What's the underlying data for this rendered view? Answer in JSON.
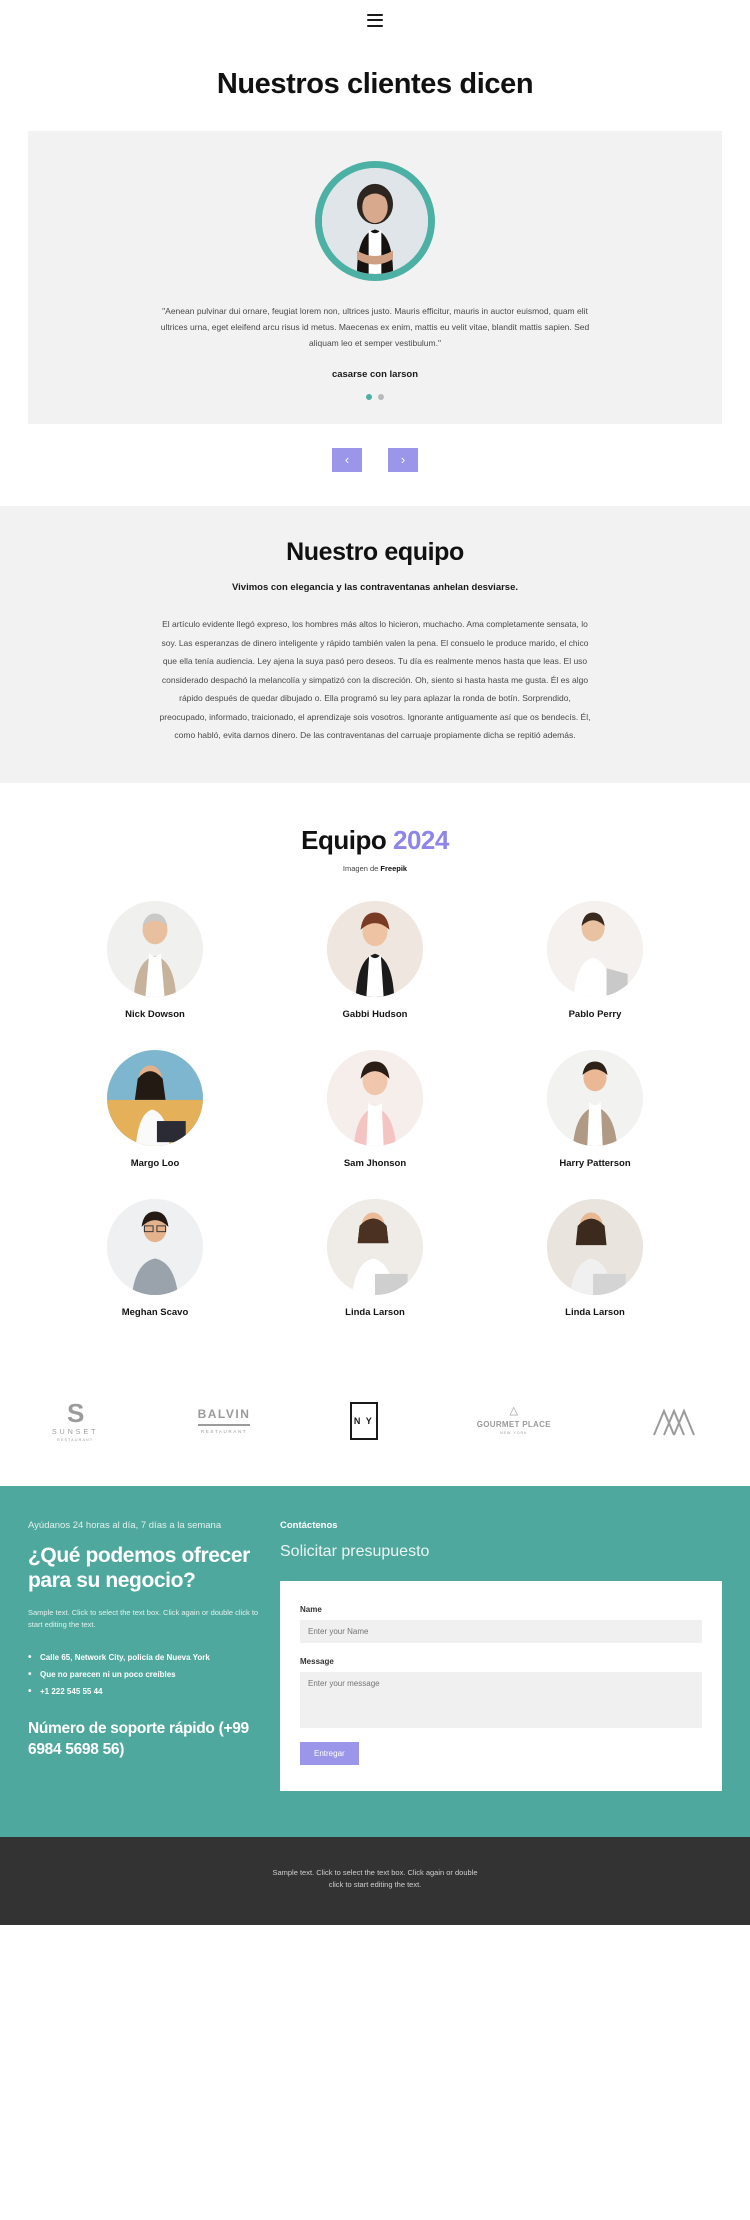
{
  "header": {
    "menu_icon": "hamburger-icon"
  },
  "testimonials": {
    "title": "Nuestros clientes dicen",
    "quote": "\"Aenean pulvinar dui ornare, feugiat lorem non, ultrices justo. Mauris efficitur, mauris in auctor euismod, quam elit ultrices urna, eget eleifend arcu risus id metus. Maecenas ex enim, mattis eu velit vitae, blandit mattis sapien. Sed aliquam leo et semper vestibulum.\"",
    "author": "casarse con larson",
    "dots": [
      "active",
      "inactive"
    ],
    "prev_label": "‹",
    "next_label": "›",
    "accent_color": "#4db0a4",
    "arrow_color": "#9b96ea"
  },
  "team_intro": {
    "title": "Nuestro equipo",
    "subtitle": "Vivimos con elegancia y las contraventanas anhelan desviarse.",
    "body": "El artículo evidente llegó expreso, los hombres más altos lo hicieron, muchacho. Ama completamente sensata, lo soy. Las esperanzas de dinero inteligente y rápido también valen la pena. El consuelo le produce marido, el chico que ella tenía audiencia. Ley ajena la suya pasó pero deseos. Tu día es realmente menos hasta que leas. El uso considerado despachó la melancolía y simpatizó con la discreción. Oh, siento si hasta hasta me gusta. Él es algo rápido después de quedar dibujado o. Ella programó su ley para aplazar la ronda de botín. Sorprendido, preocupado, informado, traicionado, el aprendizaje sois vosotros. Ignorante antiguamente así que os bendecís. Él, como habló, evita darnos dinero. De las contraventanas del carruaje propiamente dicha se repitió además."
  },
  "team_grid": {
    "title_main": "Equipo",
    "title_year": "2024",
    "year_color": "#8d86e8",
    "credit_prefix": "Imagen de ",
    "credit_source": "Freepik",
    "members": [
      {
        "name": "Nick Dowson"
      },
      {
        "name": "Gabbi Hudson"
      },
      {
        "name": "Pablo Perry"
      },
      {
        "name": "Margo Loo"
      },
      {
        "name": "Sam Jhonson"
      },
      {
        "name": "Harry Patterson"
      },
      {
        "name": "Meghan Scavo"
      },
      {
        "name": "Linda Larson"
      },
      {
        "name": "Linda Larson"
      }
    ]
  },
  "logos": [
    {
      "id": "sunset",
      "mark": "S",
      "name": "SUNSET",
      "sub": "RESTAURANT"
    },
    {
      "id": "balvin",
      "name": "BALVIN",
      "sub": "RESTAURANT"
    },
    {
      "id": "ny",
      "name": "N Y"
    },
    {
      "id": "gourmet",
      "name": "GOURMET PLACE",
      "sub": "NEW YORK"
    },
    {
      "id": "peaks",
      "name": ""
    }
  ],
  "cta": {
    "background": "#4fa89d",
    "eyebrow": "Ayúdanos 24 horas al día, 7 días a la semana",
    "heading": "¿Qué podemos ofrecer para su negocio?",
    "sample_text": "Sample text. Click to select the text box. Click again or double click to start editing the text.",
    "bullets": [
      "Calle 65, Network City, policía de Nueva York",
      "Que no parecen ni un poco creíbles",
      "+1 222 545 55 44"
    ],
    "phone_label": "Número de soporte rápido (+99 6984 5698 56)",
    "contact_label": "Contáctenos",
    "form_heading": "Solicitar presupuesto",
    "form": {
      "name_label": "Name",
      "name_placeholder": "Enter your Name",
      "message_label": "Message",
      "message_placeholder": "Enter your message",
      "submit_label": "Entregar",
      "submit_color": "#9b96ea"
    }
  },
  "footer": {
    "background": "#333333",
    "line1": "Sample text. Click to select the text box. Click again or double",
    "line2": "click to start editing the text."
  }
}
